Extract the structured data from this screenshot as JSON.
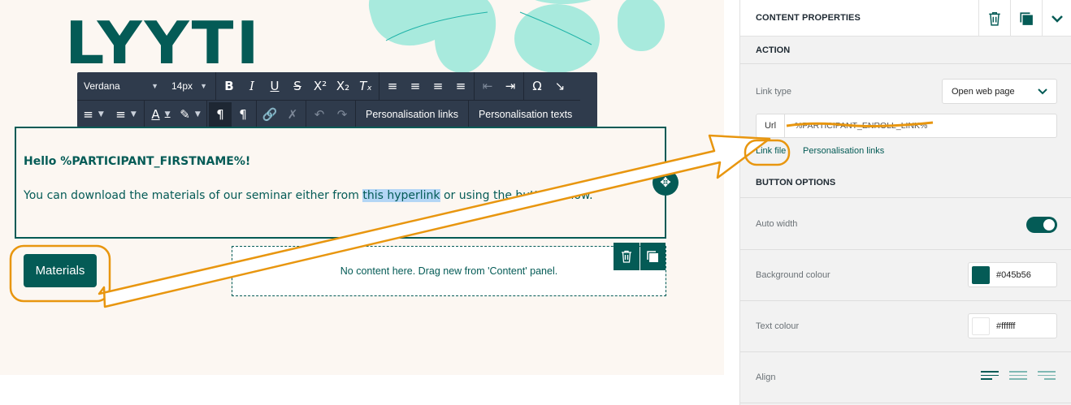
{
  "editor": {
    "logo_text": "LYYTI",
    "toolbar": {
      "font_family": "Verdana",
      "font_size": "14px",
      "personalisation_links_label": "Personalisation links",
      "personalisation_texts_label": "Personalisation texts",
      "row1_icons": [
        "bold-icon",
        "italic-icon",
        "underline-icon",
        "strikethrough-icon",
        "superscript-icon",
        "subscript-icon",
        "clear-format-icon",
        "align-left-icon",
        "align-center-icon",
        "align-right-icon",
        "align-justify-icon",
        "outdent-icon",
        "indent-icon",
        "special-character-icon",
        "collapse-icon"
      ],
      "row2_icons": [
        "ordered-list-icon",
        "unordered-list-icon",
        "text-color-icon",
        "highlight-icon",
        "ltr-icon",
        "rtl-icon",
        "link-icon",
        "unlink-icon",
        "undo-icon",
        "redo-icon"
      ]
    },
    "text_block": {
      "greeting": "Hello %PARTICIPANT_FIRSTNAME%!",
      "body_before": "You can download the materials of our seminar either from ",
      "body_highlight": "this hyperlink",
      "body_after": " or using the button below."
    },
    "button_label": "Materials",
    "empty_block_text": "No content here. Drag new from 'Content' panel."
  },
  "panel": {
    "title": "CONTENT PROPERTIES",
    "header_icons": [
      "trash-icon",
      "duplicate-icon",
      "chevron-down-icon"
    ],
    "action": {
      "section_title": "ACTION",
      "link_type_label": "Link type",
      "link_type_value": "Open web page",
      "url_prefix": "Url",
      "url_value": "%PARTICIPANT_ENROLL_LINK%",
      "link_file_label": "Link file",
      "personalisation_links_label": "Personalisation links"
    },
    "button_options": {
      "section_title": "BUTTON OPTIONS",
      "auto_width_label": "Auto width",
      "auto_width_on": true,
      "background_colour_label": "Background colour",
      "background_colour_value": "#045b56",
      "text_colour_label": "Text colour",
      "text_colour_value": "#ffffff",
      "align_label": "Align",
      "align_selected": "left"
    }
  },
  "colors": {
    "brand": "#045b56",
    "annotation": "#e8960f",
    "canvas_bg": "#fcf7f2",
    "toolbar_bg": "#2f3b4c",
    "highlight": "#b4d6f5"
  }
}
